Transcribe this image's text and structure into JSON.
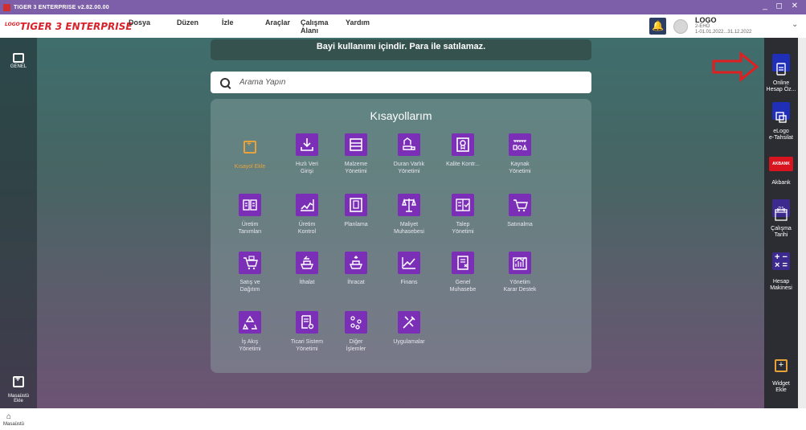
{
  "titlebar": {
    "title": "TIGER 3 ENTERPRISE v2.82.00.00",
    "controls": "_ ◻ ✕"
  },
  "menubar": {
    "brand": "TIGER 3 ENTERPRISE",
    "brand_small": "LOGO",
    "items": [
      "Dosya",
      "Düzen",
      "İzle",
      "Araçlar",
      "Çalışma Alanı",
      "Yardım"
    ]
  },
  "account": {
    "name": "LOGO",
    "firm": "2-EHÖ",
    "period": "1-01.01.2022...31.12.2022"
  },
  "left_bar": {
    "general": "GENEL",
    "add_desktop": "Masaüstü\nEkle"
  },
  "banner": {
    "text": "Bayi kullanımı içindir. Para ile satılamaz."
  },
  "search": {
    "placeholder": "Arama Yapın"
  },
  "shortcuts": {
    "title": "Kısayollarım",
    "items": [
      {
        "label": "Kısayol Ekle",
        "icon": "plus-icon"
      },
      {
        "label": "Hızlı Veri\nGirişi",
        "icon": "download-icon"
      },
      {
        "label": "Malzeme\nYönetimi",
        "icon": "list-icon"
      },
      {
        "label": "Duran Varlık\nYönetimi",
        "icon": "truck-home-icon"
      },
      {
        "label": "Kalite Kontr...",
        "icon": "badge-icon"
      },
      {
        "label": "Kaynak\nYönetimi",
        "icon": "resource-icon"
      },
      {
        "label": "Üretim\nTanımları",
        "icon": "production-def-icon"
      },
      {
        "label": "Üretim\nKontrol",
        "icon": "line-chart-icon"
      },
      {
        "label": "Planlama",
        "icon": "planning-icon"
      },
      {
        "label": "Maliyet\nMuhasebesi",
        "icon": "scale-icon"
      },
      {
        "label": "Talep\nYönetimi",
        "icon": "check-list-icon"
      },
      {
        "label": "Satınalma",
        "icon": "cart-icon"
      },
      {
        "label": "Satış ve\nDağıtım",
        "icon": "sales-cart-icon"
      },
      {
        "label": "İthalat",
        "icon": "ship-import-icon"
      },
      {
        "label": "İhracat",
        "icon": "ship-export-icon"
      },
      {
        "label": "Finans",
        "icon": "finance-chart-icon"
      },
      {
        "label": "Genel\nMuhasebe",
        "icon": "ledger-icon"
      },
      {
        "label": "Yönetim\nKarar Destek",
        "icon": "decision-icon"
      },
      {
        "label": "İş Akış\nYönetimi",
        "icon": "recycle-icon"
      },
      {
        "label": "Ticari Sistem\nYönetimi",
        "icon": "doc-gear-icon"
      },
      {
        "label": "Diğer\nİşlemler",
        "icon": "dots-icon"
      },
      {
        "label": "Uygulamalar",
        "icon": "tools-icon"
      }
    ]
  },
  "right_bar": [
    {
      "label": "Online\nHesap Öz...",
      "icon": "online-account-icon"
    },
    {
      "label": "eLogo\ne-Tahsilat",
      "icon": "elogo-icon"
    },
    {
      "label": "Akbank",
      "icon": "akbank-icon"
    },
    {
      "label": "Çalışma\nTarihi",
      "icon": "calendar-icon",
      "day": "21"
    },
    {
      "label": "Hesap\nMakinesi",
      "icon": "calculator-icon"
    },
    {
      "label": "Widget\nEkle",
      "icon": "widget-add-icon"
    }
  ],
  "akbank_logo": "AKBANK",
  "bottom": {
    "desktop_label": "Masaüstü"
  },
  "colors": {
    "accent_purple": "#7b2fb6",
    "brand_red": "#d8232a",
    "arrow_red": "#e02020"
  }
}
